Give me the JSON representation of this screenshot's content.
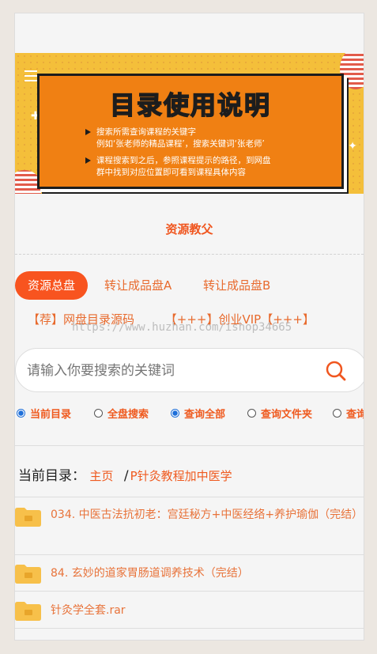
{
  "banner": {
    "title": "目录使用说明",
    "lines": [
      "搜索所需查询课程的关键字",
      "例如‘张老师的精品课程’，搜索关键词‘张老师’",
      "课程搜索到之后，参照课程提示的路径，到网盘",
      "群中找到对应位置即可看到课程具体内容"
    ]
  },
  "site_title": "资源教父",
  "tabs": [
    {
      "label": "资源总盘",
      "active": true
    },
    {
      "label": "转让成品盘A",
      "active": false
    },
    {
      "label": "转让成品盘B",
      "active": false
    }
  ],
  "links": [
    "【荐】网盘目录源码",
    "【+++】创业VIP【+++】"
  ],
  "watermark": "https://www.huzhan.com/ishop34665",
  "search": {
    "placeholder": "请输入你要搜索的关键词"
  },
  "radios": [
    {
      "label": "当前目录",
      "checked": true
    },
    {
      "label": "全盘搜索",
      "checked": false
    },
    {
      "label": "查询全部",
      "checked": true
    },
    {
      "label": "查询文件夹",
      "checked": false
    },
    {
      "label": "查询",
      "checked": false
    }
  ],
  "breadcrumb": {
    "label": "当前目录：",
    "home": "主页",
    "separator": "/",
    "current": "P针灸教程加中医学"
  },
  "items": [
    {
      "name": "034. 中医古法抗初老：宫廷秘方+中医经络+养护瑜伽（完结）",
      "type": "folder"
    },
    {
      "name": "84. 玄妙的道家胃肠道调养技术（完结）",
      "type": "folder"
    },
    {
      "name": "针灸学全套.rar",
      "type": "file"
    }
  ],
  "colors": {
    "accent": "#f8541f",
    "link": "#e86a2d",
    "banner_bg": "#f4bf3a",
    "panel": "#f08013",
    "folder": "#f7c04a"
  }
}
